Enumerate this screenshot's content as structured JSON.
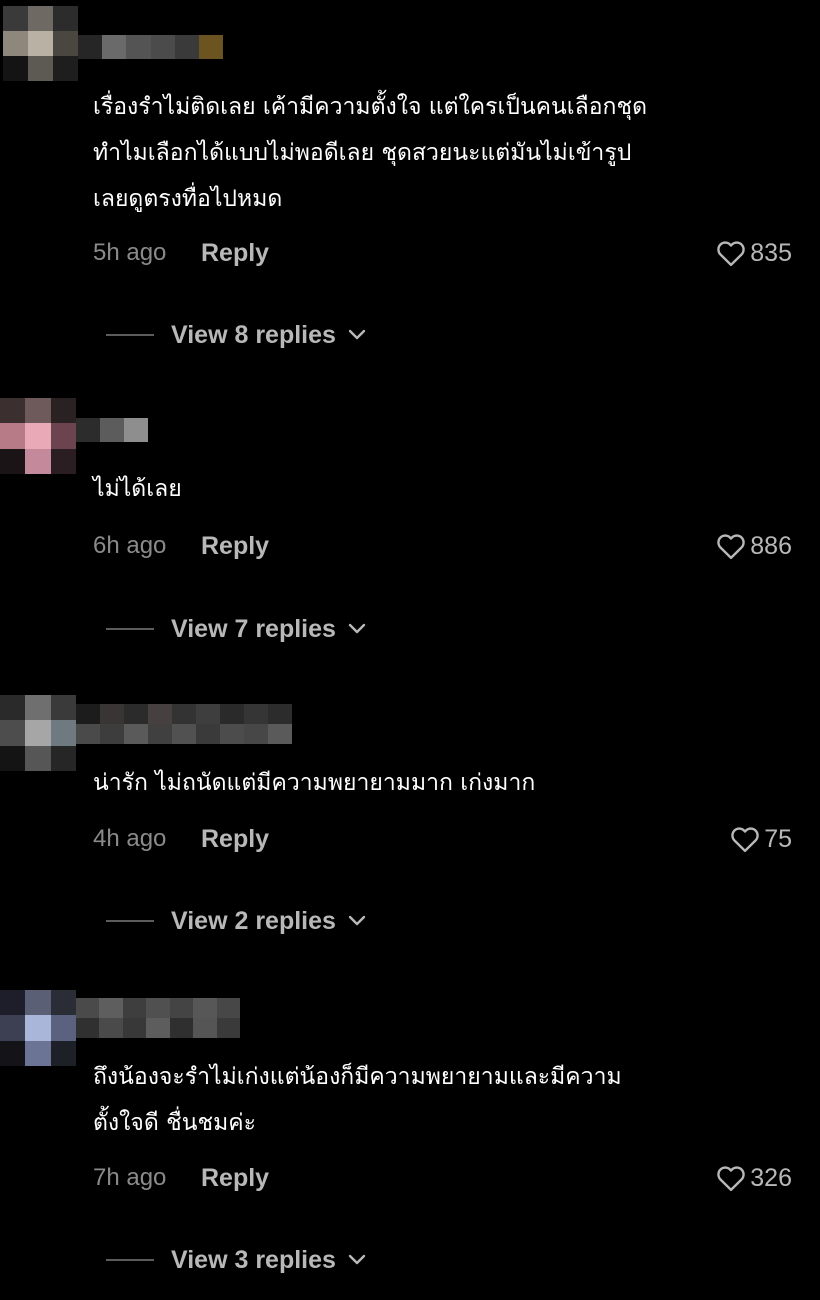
{
  "comments": [
    {
      "text": "เรื่องรำไม่ติดเลย เค้ามีความตั้งใจ แต่ใครเป็นคนเลือกชุด\nทำไมเลือกได้แบบไม่พอดีเลย ชุดสวยนะแต่มันไม่เข้ารูป\nเลยดูตรงทื่อไปหมด",
      "time": "5h ago",
      "reply_label": "Reply",
      "likes": "835",
      "view_replies": "View 8 replies"
    },
    {
      "text": "ไม่ได้เลย",
      "time": "6h ago",
      "reply_label": "Reply",
      "likes": "886",
      "view_replies": "View 7 replies"
    },
    {
      "text": "น่ารัก ไม่ถนัดแต่มีความพยายามมาก เก่งมาก",
      "time": "4h ago",
      "reply_label": "Reply",
      "likes": "75",
      "view_replies": "View 2 replies"
    },
    {
      "text": "ถึงน้องจะรำไม่เก่งแต่น้องก็มีความพยายามและมีความ\nตั้งใจดี ชื่นชมค่ะ",
      "time": "7h ago",
      "reply_label": "Reply",
      "likes": "326",
      "view_replies": "View 3 replies"
    }
  ],
  "colors": {
    "background": "#000000",
    "text": "#ffffff",
    "muted": "#8a8a8a",
    "action": "#b8b8b8"
  },
  "icons": {
    "like": "heart-outline-icon",
    "expand": "chevron-down-icon"
  }
}
